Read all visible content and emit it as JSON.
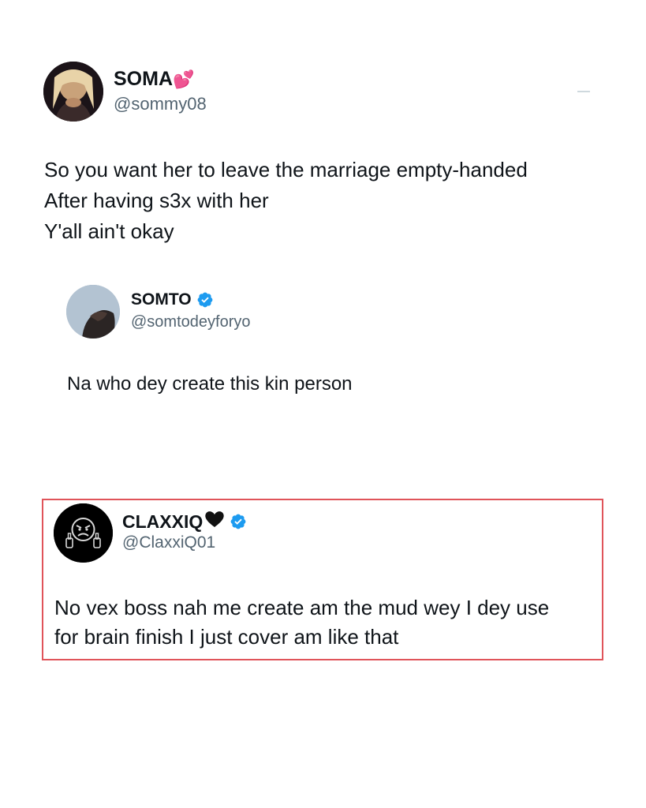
{
  "tweets": [
    {
      "display_name": "SOMA",
      "name_emoji": "💕",
      "handle": "@sommy08",
      "verified": false,
      "body_lines": [
        "So you want her to leave the marriage empty-handed",
        "After having s3x with her",
        "Y'all ain't okay"
      ]
    },
    {
      "display_name": "SOMTO",
      "handle": "@somtodeyforyo",
      "verified": true,
      "body_lines": [
        "Na who dey create this kin person"
      ]
    },
    {
      "display_name": "CLAXXIQ",
      "name_emoji": "🖤",
      "handle": "@ClaxxiQ01",
      "verified": true,
      "highlighted": true,
      "body_lines": [
        "No vex boss nah me create am the mud wey I dey use",
        "for brain finish I just cover am like that"
      ]
    }
  ],
  "icons": {
    "verified_badge": "verified-badge-icon",
    "avatar_3": "angry-face-middle-finger-icon"
  },
  "colors": {
    "text": "#0f1419",
    "handle": "#536471",
    "verified": "#1d9bf0",
    "highlight_border": "#e0545a"
  }
}
